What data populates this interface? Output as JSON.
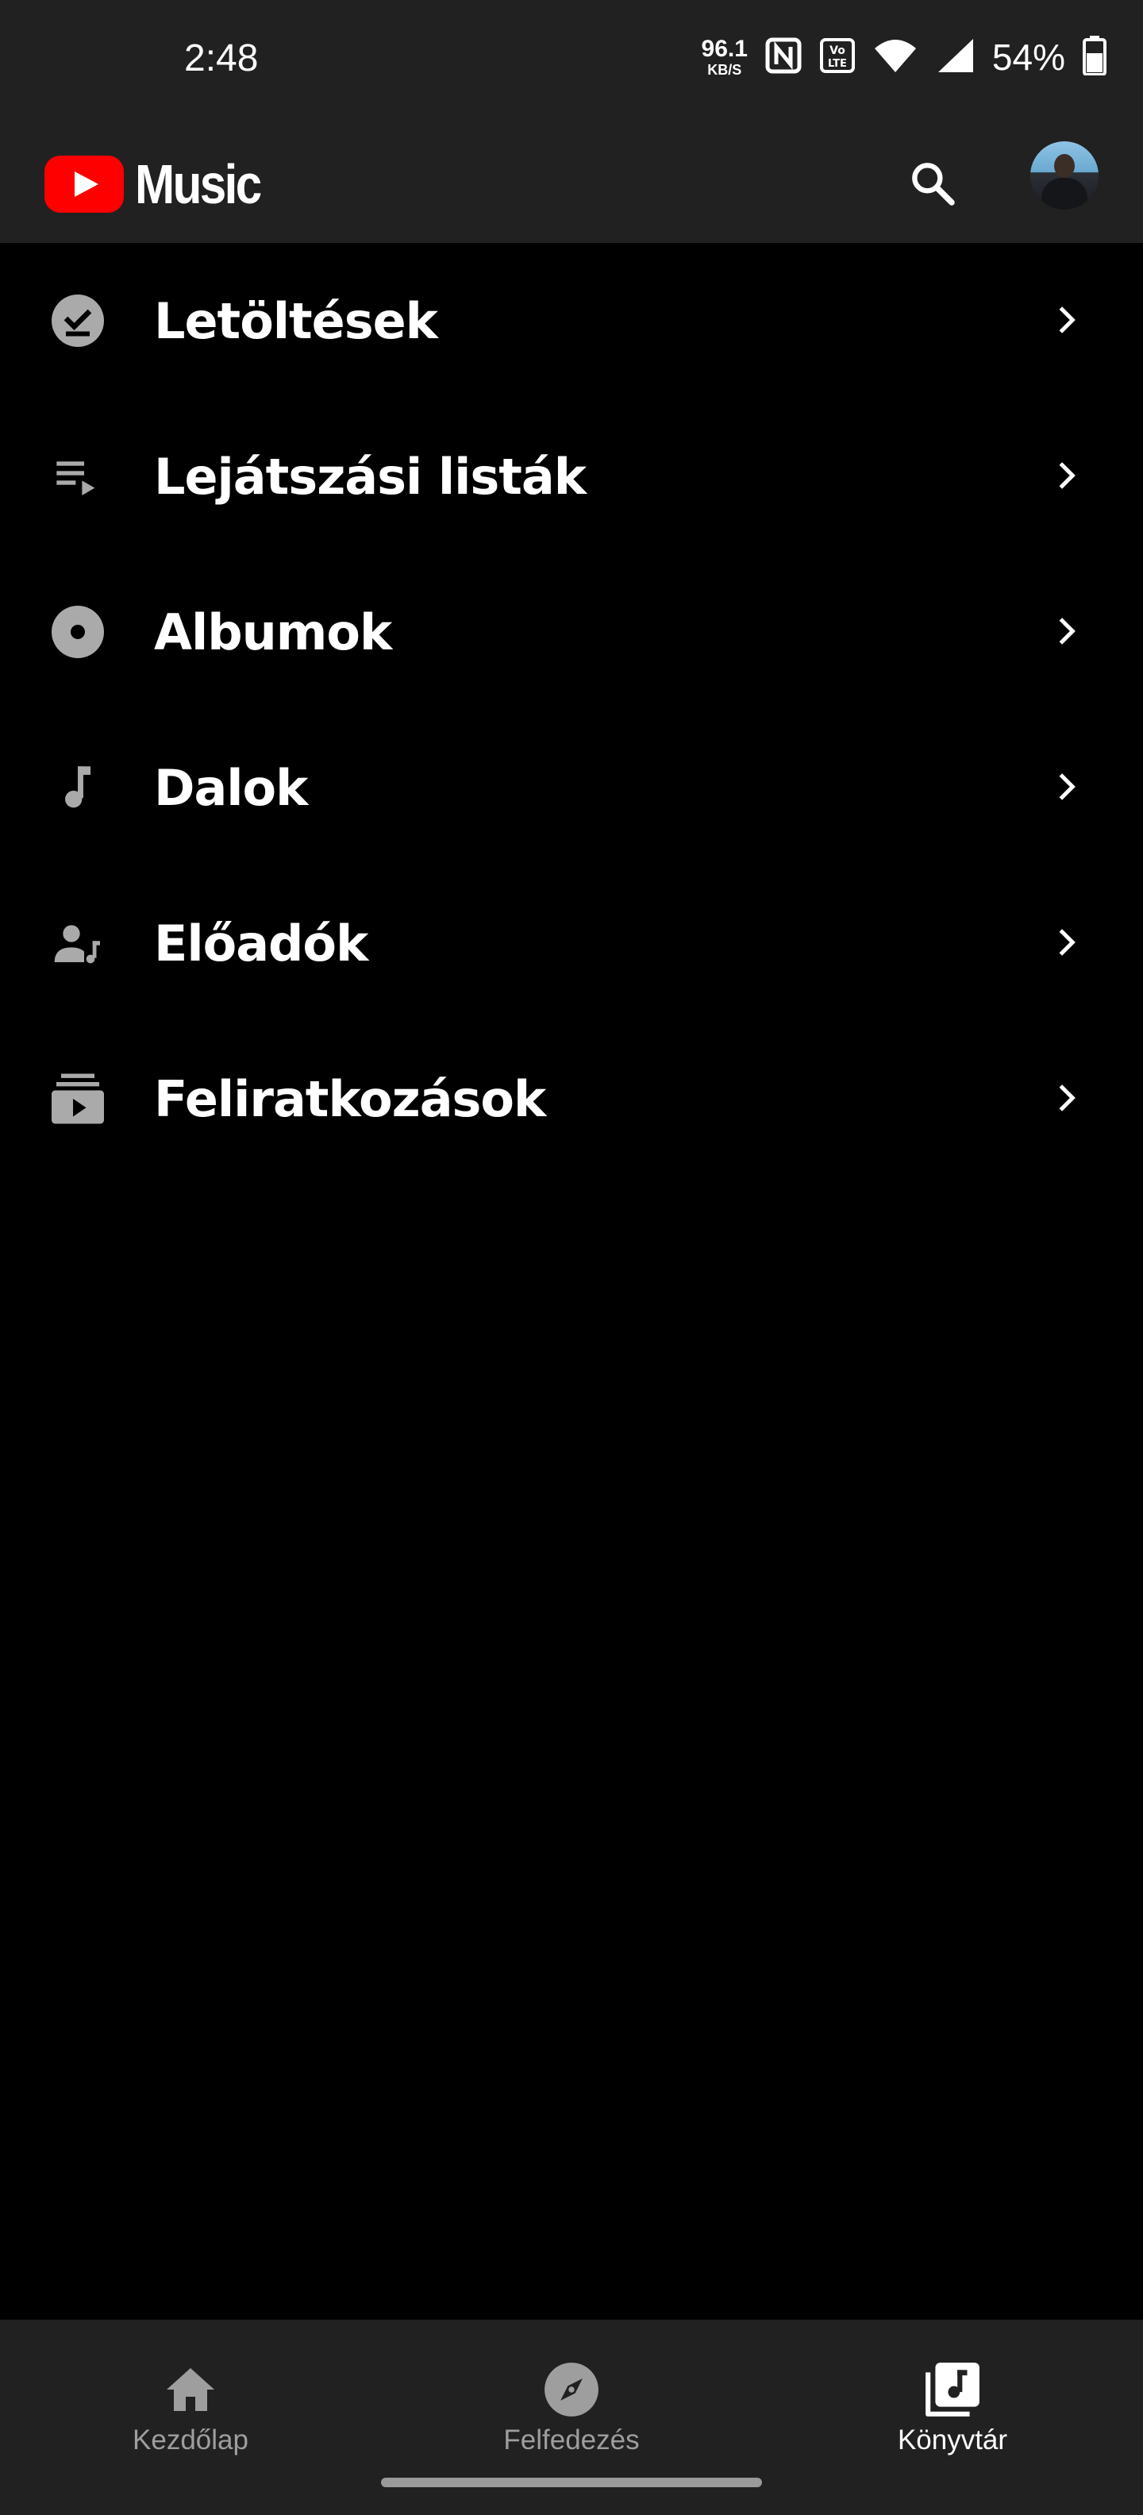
{
  "status_bar": {
    "time": "2:48",
    "net_speed_value": "96.1",
    "net_speed_unit": "KB/S",
    "battery_percent": "54%",
    "icons": [
      "nfc-icon",
      "volte-icon",
      "wifi-icon",
      "signal-icon",
      "battery-icon"
    ]
  },
  "header": {
    "app_name": "Music",
    "logo_color": "#ff0000",
    "search_icon": "search-icon",
    "avatar": "account-avatar"
  },
  "library": {
    "items": [
      {
        "label": "Letöltések",
        "icon": "download-done-icon"
      },
      {
        "label": "Lejátszási listák",
        "icon": "playlist-icon"
      },
      {
        "label": "Albumok",
        "icon": "album-icon"
      },
      {
        "label": "Dalok",
        "icon": "music-note-icon"
      },
      {
        "label": "Előadók",
        "icon": "artist-icon"
      },
      {
        "label": "Feliratkozások",
        "icon": "subscriptions-icon"
      }
    ]
  },
  "bottom_nav": {
    "items": [
      {
        "label": "Kezdőlap",
        "icon": "home-icon",
        "active": false
      },
      {
        "label": "Felfedezés",
        "icon": "explore-icon",
        "active": false
      },
      {
        "label": "Könyvtár",
        "icon": "library-music-icon",
        "active": true
      }
    ]
  },
  "colors": {
    "bar_background": "#212121",
    "page_background": "#000000",
    "icon_gray": "#aaaaaa",
    "inactive_label": "#9e9e9e"
  }
}
